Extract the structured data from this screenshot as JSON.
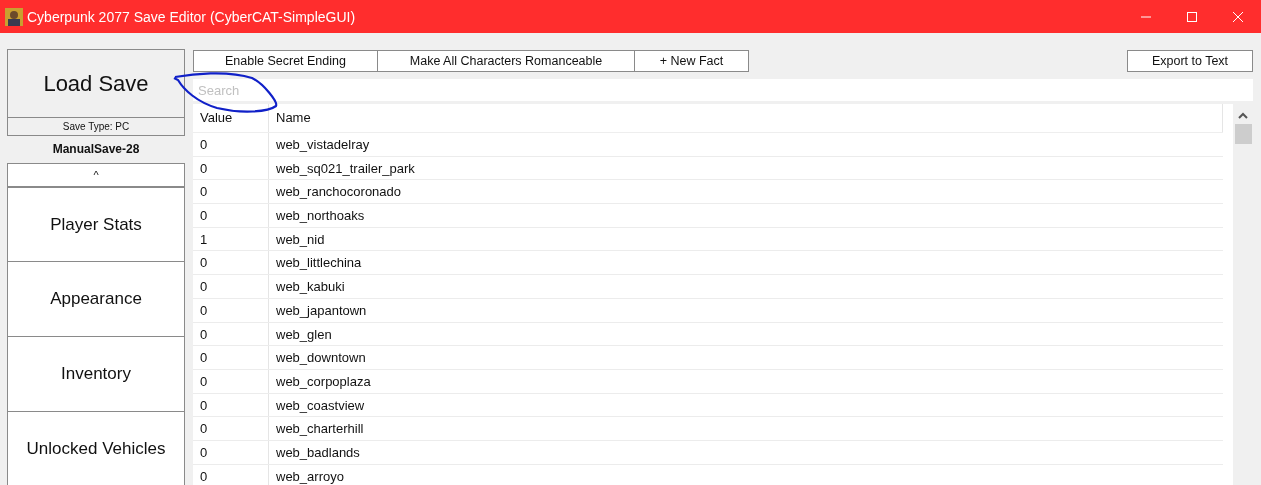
{
  "window": {
    "title": "Cyberpunk 2077 Save Editor (CyberCAT-SimpleGUI)"
  },
  "sidebar": {
    "load_button": "Load Save",
    "save_type": "Save Type: PC",
    "save_name": "ManualSave-28",
    "collapse_button": "^",
    "items": [
      "Player Stats",
      "Appearance",
      "Inventory",
      "Unlocked Vehicles"
    ]
  },
  "toolbar": {
    "buttons": [
      "Enable Secret Ending",
      "Make All Characters Romanceable",
      "+ New Fact"
    ],
    "export_button": "Export to Text"
  },
  "search": {
    "placeholder": "Search"
  },
  "table": {
    "columns": [
      "Value",
      "Name"
    ],
    "rows": [
      [
        "0",
        "web_vistadelray"
      ],
      [
        "0",
        "web_sq021_trailer_park"
      ],
      [
        "0",
        "web_ranchocoronado"
      ],
      [
        "0",
        "web_northoaks"
      ],
      [
        "1",
        "web_nid"
      ],
      [
        "0",
        "web_littlechina"
      ],
      [
        "0",
        "web_kabuki"
      ],
      [
        "0",
        "web_japantown"
      ],
      [
        "0",
        "web_glen"
      ],
      [
        "0",
        "web_downtown"
      ],
      [
        "0",
        "web_corpoplaza"
      ],
      [
        "0",
        "web_coastview"
      ],
      [
        "0",
        "web_charterhill"
      ],
      [
        "0",
        "web_badlands"
      ],
      [
        "0",
        "web_arroyo"
      ]
    ]
  }
}
